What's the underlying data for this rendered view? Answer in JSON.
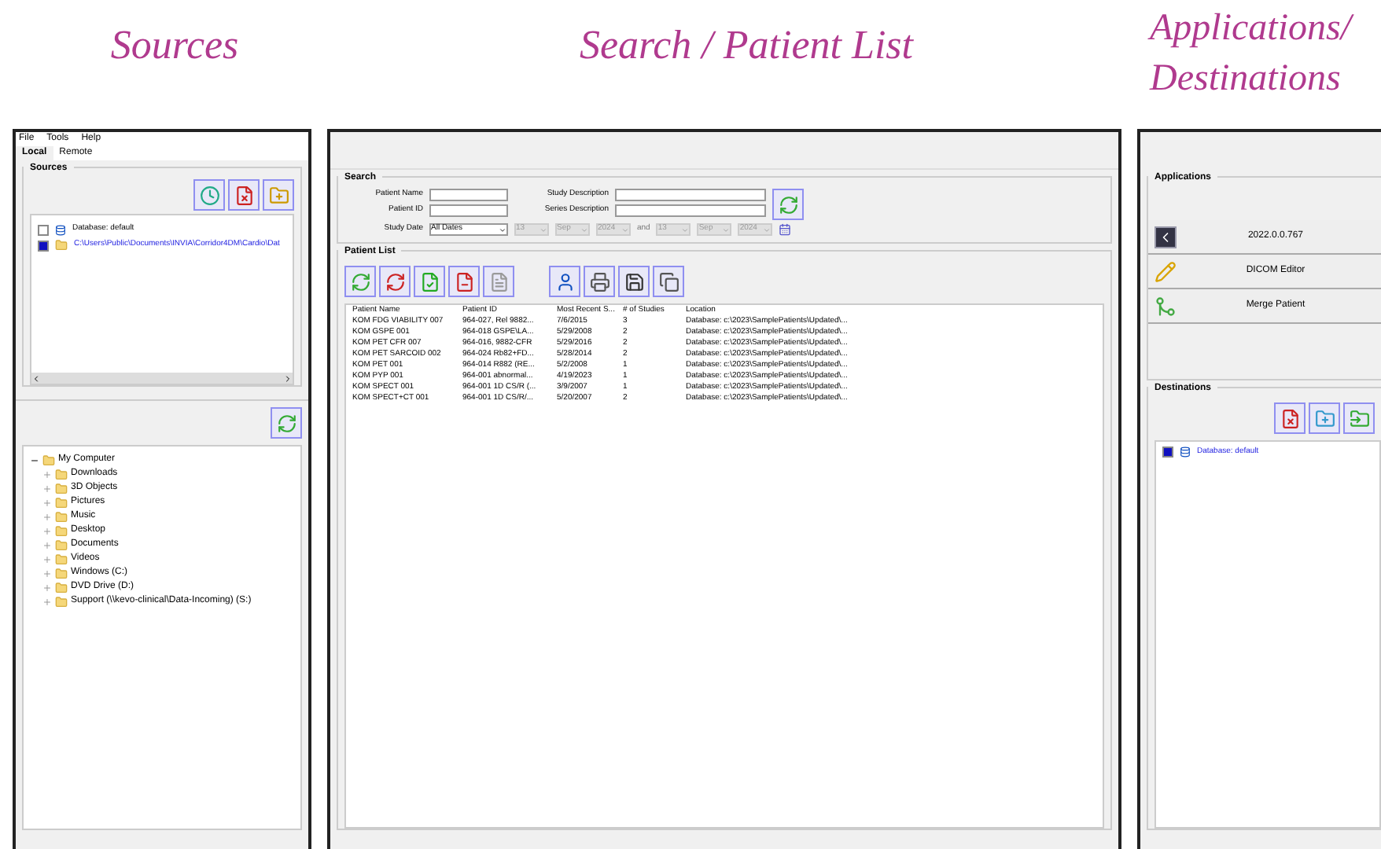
{
  "headings": [
    "Sources",
    "Search / Patient List",
    "Applications/ Destinations"
  ],
  "sources_window": {
    "menu": [
      "File",
      "Tools",
      "Help"
    ],
    "tabs": [
      {
        "label": "Local",
        "selected": true
      },
      {
        "label": "Remote",
        "selected": false
      }
    ],
    "sources_title": "Sources",
    "sources": [
      {
        "label": "Database: default",
        "checked": false,
        "kind": "database"
      },
      {
        "label": "C:\\Users\\Public\\Documents\\INVIA\\Corridor4DM\\Cardio\\Dat",
        "checked": true,
        "kind": "folder"
      }
    ],
    "tree": [
      {
        "label": "My Computer",
        "expanded": true,
        "children": [
          {
            "label": "Downloads"
          },
          {
            "label": "3D Objects"
          },
          {
            "label": "Pictures"
          },
          {
            "label": "Music"
          },
          {
            "label": "Desktop"
          },
          {
            "label": "Documents"
          },
          {
            "label": "Videos"
          },
          {
            "label": "Windows (C:)"
          },
          {
            "label": "DVD Drive (D:)"
          },
          {
            "label": "Support (\\\\kevo-clinical\\Data-Incoming) (S:)"
          }
        ]
      }
    ]
  },
  "search_window": {
    "search_title": "Search",
    "fields": [
      {
        "label": "Patient Name"
      },
      {
        "label": "Patient ID"
      },
      {
        "label": "Study Description"
      },
      {
        "label": "Series Description"
      }
    ],
    "study_date": {
      "label": "Study Date",
      "range": "All Dates",
      "from": [
        "13",
        "Sep",
        "2024"
      ],
      "joiner": "and",
      "to": [
        "13",
        "Sep",
        "2024"
      ]
    },
    "list_title": "Patient List",
    "table": {
      "columns": [
        "Patient Name",
        "Patient ID",
        "Most Recent S...",
        "# of Studies",
        "Location"
      ],
      "rows": [
        [
          "KOM FDG VIABILITY 007",
          "964-027, Rel 9882...",
          "7/6/2015",
          "3",
          "Database: c:\\2023\\SamplePatients\\Updated\\..."
        ],
        [
          "KOM GSPE 001",
          "964-018 GSPE\\LA...",
          "5/29/2008",
          "2",
          "Database: c:\\2023\\SamplePatients\\Updated\\..."
        ],
        [
          "KOM PET CFR 007",
          "964-016, 9882-CFR",
          "5/29/2016",
          "2",
          "Database: c:\\2023\\SamplePatients\\Updated\\..."
        ],
        [
          "KOM PET SARCOID 002",
          "964-024 Rb82+FD...",
          "5/28/2014",
          "2",
          "Database: c:\\2023\\SamplePatients\\Updated\\..."
        ],
        [
          "KOM PET 001",
          "964-014 R882 (RE...",
          "5/2/2008",
          "1",
          "Database: c:\\2023\\SamplePatients\\Updated\\..."
        ],
        [
          "KOM PYP 001",
          "964-001 abnormal...",
          "4/19/2023",
          "1",
          "Database: c:\\2023\\SamplePatients\\Updated\\..."
        ],
        [
          "KOM SPECT 001",
          "964-001 1D CS/R (...",
          "3/9/2007",
          "1",
          "Database: c:\\2023\\SamplePatients\\Updated\\..."
        ],
        [
          "KOM SPECT+CT 001",
          "964-001 1D CS/R/...",
          "5/20/2007",
          "2",
          "Database: c:\\2023\\SamplePatients\\Updated\\..."
        ]
      ]
    }
  },
  "apps_window": {
    "apps_title": "Applications",
    "apps": [
      {
        "label": "2022.0.0.767",
        "kind": "app"
      },
      {
        "label": "DICOM Editor",
        "kind": "editor"
      },
      {
        "label": "Merge Patient",
        "kind": "merge"
      }
    ],
    "dest_title": "Destinations",
    "destinations": [
      {
        "label": "Database: default",
        "checked": true
      }
    ]
  }
}
